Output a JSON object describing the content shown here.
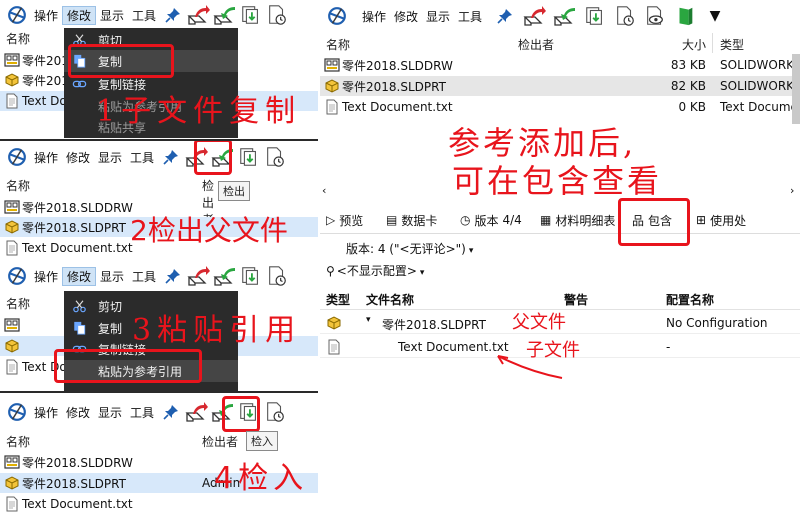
{
  "menus": {
    "operations": "操作",
    "modify": "修改",
    "display": "显示",
    "tools": "工具"
  },
  "columns": {
    "name": "名称",
    "checked_out_by": "检出者",
    "size": "大小",
    "type": "类型"
  },
  "files": {
    "drawing": "零件2018.SLDDRW",
    "part": "零件2018.SLDPRT",
    "text": "Text Document.txt",
    "drawing_trunc": "零件2018",
    "part_trunc": "零件2018",
    "text_trunc": "Text Docu"
  },
  "sizes": {
    "drawing": "83 KB",
    "part": "82 KB",
    "text": "0 KB"
  },
  "types": {
    "drawing": "SOLIDWORK...",
    "part": "SOLIDWORK...",
    "text": "Text Docume..."
  },
  "context_menu": {
    "cut": "剪切",
    "copy": "复制",
    "copy_link": "复制链接",
    "paste_as_reference": "粘贴为参考引用",
    "paste_share": "粘贴共享"
  },
  "tooltips": {
    "check_out": "检出",
    "check_in": "检入"
  },
  "user": "Admin",
  "tabs": {
    "preview": "预览",
    "datacard": "数据卡",
    "version": "版本",
    "version_count": "4/4",
    "bom": "材料明细表",
    "contains": "包含",
    "where_used": "使用处"
  },
  "version_select": "版本: 4 (\"<无评论>\")",
  "config_select": "<不显示配置>",
  "contains_columns": {
    "type": "类型",
    "filename": "文件名称",
    "warning": "警告",
    "config": "配置名称"
  },
  "contains_rows": {
    "parent_name": "零件2018.SLDPRT",
    "parent_config": "No Configuration",
    "child_name": "Text Document.txt",
    "child_config": "-"
  },
  "annotations": {
    "step1": "1子文件复制",
    "step2": "2检出父文件",
    "step3": "3粘贴引用",
    "step4": "4检入",
    "note_line1": "参考添加后,",
    "note_line2": "可在包含查看",
    "parent_label": "父文件",
    "child_label": "子文件"
  },
  "colors": {
    "annotation": "#e8141c",
    "selection": "#d7e8fa",
    "menu_dark": "#2b2b2b",
    "accent_green": "#2aa640"
  }
}
